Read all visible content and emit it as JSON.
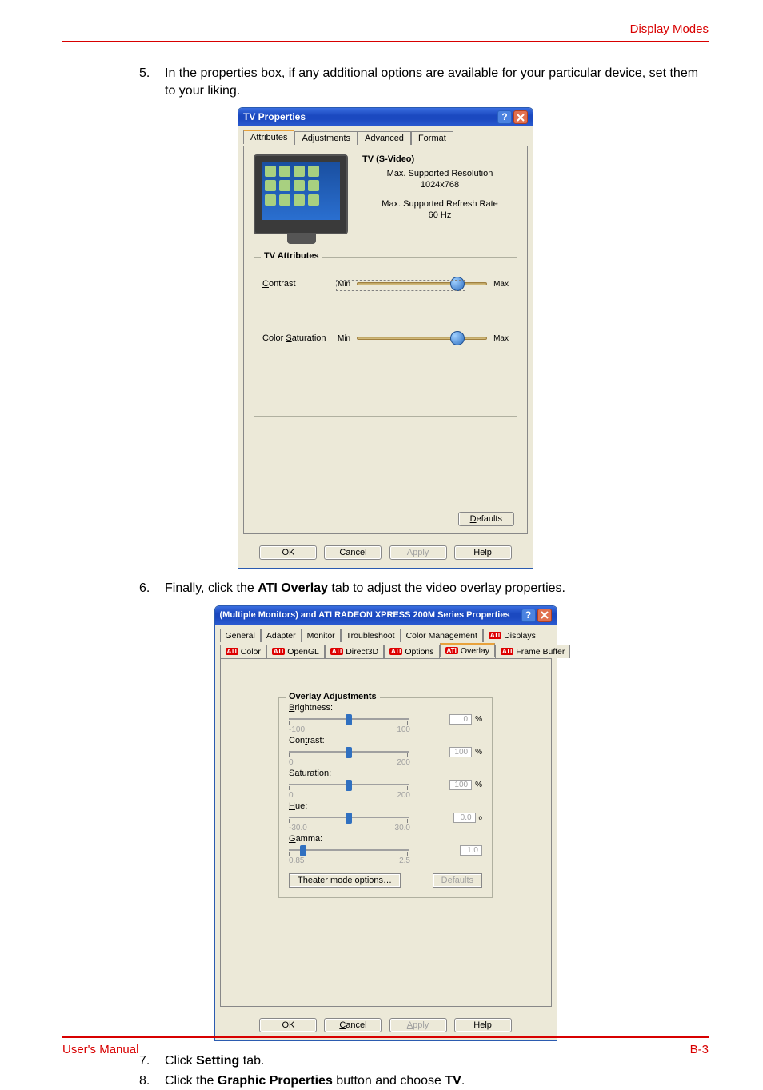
{
  "page": {
    "header": "Display Modes",
    "footer_left": "User's Manual",
    "footer_right": "B-3"
  },
  "steps": {
    "s5_num": "5.",
    "s5_text_a": "In the properties box, if any additional options are available for your particular device, set them to your liking.",
    "s6_num": "6.",
    "s6_text_a": "Finally, click the ",
    "s6_bold": "ATI Overlay",
    "s6_text_b": " tab to adjust the video overlay properties.",
    "s7_num": "7.",
    "s7_text_a": "Click ",
    "s7_bold": "Setting",
    "s7_text_b": " tab.",
    "s8_num": "8.",
    "s8_text_a": "Click the ",
    "s8_bold1": "Graphic Properties",
    "s8_text_b": " button and choose ",
    "s8_bold2": "TV",
    "s8_text_c": "."
  },
  "dlg1": {
    "title": "TV Properties",
    "help": "?",
    "tabs": [
      "Attributes",
      "Adjustments",
      "Advanced",
      "Format"
    ],
    "info_title": "TV (S-Video)",
    "info_res_lbl": "Max. Supported Resolution",
    "info_res_val": "1024x768",
    "info_rate_lbl": "Max. Supported Refresh Rate",
    "info_rate_val": "60 Hz",
    "group_title": "TV Attributes",
    "contrast_lbl": "Contrast",
    "contrast_u": "C",
    "min": "Min",
    "max": "Max",
    "sat_lbl": "Color Saturation",
    "sat_u": "S",
    "defaults": "Defaults",
    "defaults_u": "D",
    "ok": "OK",
    "cancel": "Cancel",
    "apply": "Apply",
    "help_btn": "Help"
  },
  "dlg2": {
    "title": "(Multiple Monitors) and ATI RADEON XPRESS 200M Series Properties",
    "help": "?",
    "tabs_row1": [
      "General",
      "Adapter",
      "Monitor",
      "Troubleshoot",
      "Color Management",
      "Displays"
    ],
    "tabs_row2": [
      "Color",
      "OpenGL",
      "Direct3D",
      "Options",
      "Overlay",
      "Frame Buffer"
    ],
    "ati_flags_row1": [
      false,
      false,
      false,
      false,
      false,
      true
    ],
    "ati_flags_row2": [
      true,
      true,
      true,
      true,
      true,
      true
    ],
    "active_tab": "Overlay",
    "group_title": "Overlay Adjustments",
    "brightness_lbl": "Brightness:",
    "brightness_u": "B",
    "brightness_min": "-100",
    "brightness_max": "100",
    "brightness_val": "0",
    "brightness_unit": "%",
    "contrast_lbl": "Contrast:",
    "contrast_u": "t",
    "contrast_min": "0",
    "contrast_max": "200",
    "contrast_val": "100",
    "contrast_unit": "%",
    "saturation_lbl": "Saturation:",
    "saturation_u": "S",
    "saturation_min": "0",
    "saturation_max": "200",
    "saturation_val": "100",
    "saturation_unit": "%",
    "hue_lbl": "Hue:",
    "hue_u": "H",
    "hue_min": "-30.0",
    "hue_max": "30.0",
    "hue_val": "0.0",
    "hue_unit": "o",
    "gamma_lbl": "Gamma:",
    "gamma_u": "G",
    "gamma_min": "0.85",
    "gamma_max": "2.5",
    "gamma_val": "1.0",
    "gamma_unit": "",
    "theater": "Theater mode options…",
    "theater_u": "T",
    "defaults": "Defaults",
    "ok": "OK",
    "cancel": "Cancel",
    "cancel_u": "C",
    "apply": "Apply",
    "apply_u": "A",
    "help_btn": "Help"
  }
}
